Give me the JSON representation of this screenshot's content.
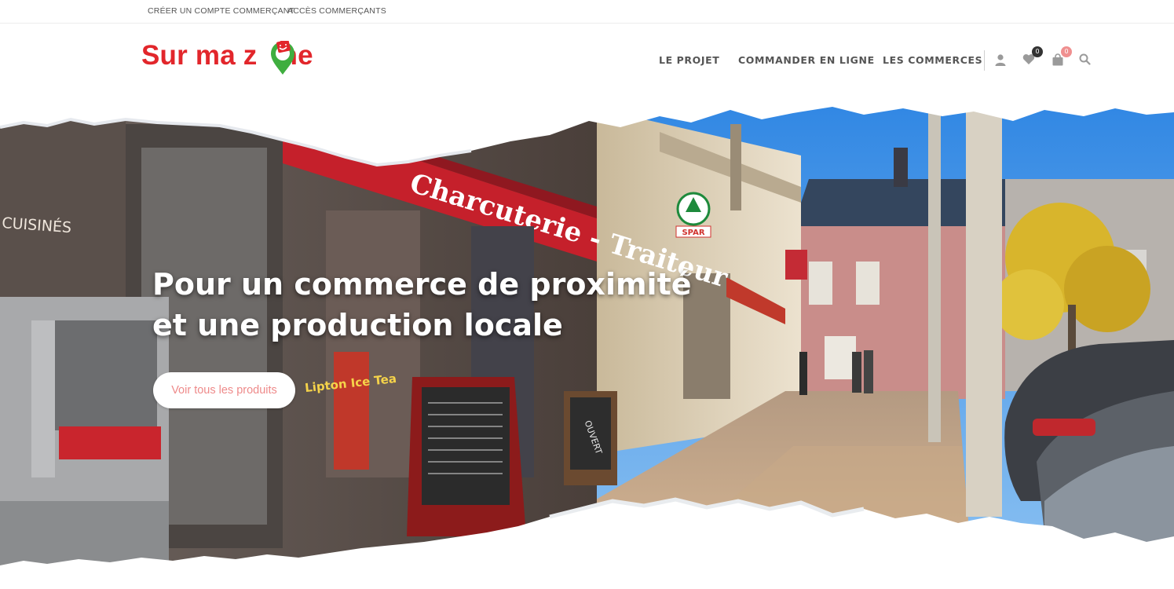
{
  "topbar": {
    "create_account": "CRÉER UN COMPTE COMMERÇANT",
    "merchant_access": "ACCÈS COMMERÇANTS"
  },
  "brand": {
    "logo_text_before": "Sur ma z",
    "logo_text_after": "ne",
    "logo_color": "#e2262b",
    "pin_color": "#3fae3f"
  },
  "nav": {
    "items": [
      {
        "label": "LE PROJET"
      },
      {
        "label": "COMMANDER EN LIGNE"
      },
      {
        "label": "LES COMMERCES"
      }
    ]
  },
  "header_icons": {
    "user": "user-icon",
    "wishlist": "heart-icon",
    "wishlist_count": "0",
    "cart": "shopping-bag-icon",
    "cart_count": "0",
    "search": "search-icon"
  },
  "hero": {
    "title_line1": "Pour un commerce de proximité",
    "title_line2": "et une production locale",
    "cta_label": "Voir tous les produits",
    "cta_text_color": "#ee8a8a",
    "image_subject": "street with shops",
    "signs": {
      "awning": "Charcuterie - Traiteur",
      "cuisines": "CUISINÉS",
      "spar": "SPAR",
      "ouvert": "OUVERT",
      "lipton": "Lipton Ice Tea"
    }
  }
}
